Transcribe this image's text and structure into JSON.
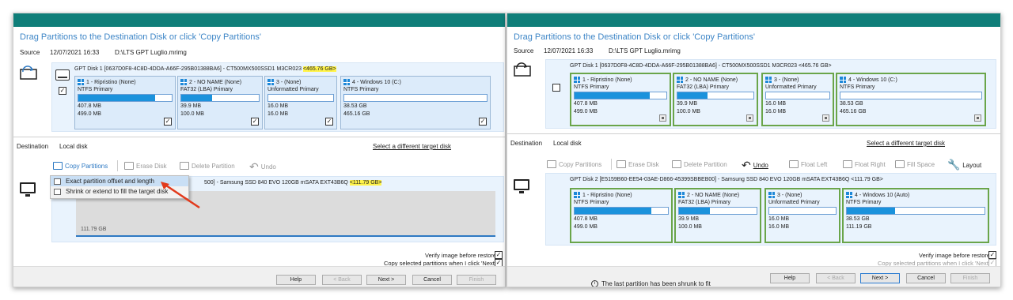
{
  "left": {
    "heading": "Drag Partitions to the Destination Disk or click 'Copy Partitions'",
    "source_label": "Source",
    "source_date": "12/07/2021 16:33",
    "source_path": "D:\\LTS GPT Luglio.mrimg",
    "disk_info": "GPT Disk 1 [0637D0F8-4C8D-4DDA-A66F-295B01388BA6] - CT500MX500SSD1 M3CR023",
    "disk_size": "<465.76 GB>",
    "partitions": [
      {
        "title": "1 - Ripristino (None)",
        "type": "NTFS Primary",
        "used": "407.8 MB",
        "total": "499.0 MB",
        "fill": 0.82
      },
      {
        "title": "2 - NO NAME (None)",
        "type": "FAT32 (LBA) Primary",
        "used": "39.9 MB",
        "total": "100.0 MB",
        "fill": 0.4
      },
      {
        "title": "3 - (None)",
        "type": "Unformatted Primary",
        "used": "16.0 MB",
        "total": "16.0 MB",
        "fill": 0.0
      },
      {
        "title": "4 - Windows 10 (C:)",
        "type": "NTFS Primary",
        "used": "38.53 GB",
        "total": "465.16 GB",
        "fill": 0.0
      }
    ],
    "destination_label": "Destination",
    "destination_value": "Local disk",
    "select_target": "Select a different target disk",
    "toolbar": {
      "copy": "Copy Partitions",
      "erase": "Erase Disk",
      "delete": "Delete Partition",
      "undo": "Undo"
    },
    "dest_disk_info": "500] - Samsung SSD 840 EVO 120GB mSATA EXT43B6Q",
    "dest_disk_size": "<111.79 GB>",
    "dest_free": "111.79 GB",
    "menu": {
      "item1": "Exact partition offset and length",
      "item2": "Shrink or extend to fill the target disk"
    },
    "verify": "Verify image before restore",
    "copy_selected": "Copy selected partitions when I click 'Next'",
    "buttons": {
      "help": "Help",
      "back": "< Back",
      "next": "Next >",
      "cancel": "Cancel",
      "finish": "Finish"
    }
  },
  "right": {
    "heading": "Drag Partitions to the Destination Disk or click 'Copy Partitions'",
    "source_label": "Source",
    "source_date": "12/07/2021 16:33",
    "source_path": "D:\\LTS GPT Luglio.mrimg",
    "disk_info": "GPT Disk 1 [0637D0F8-4C8D-4DDA-A66F-295B01388BA6] - CT500MX500SSD1 M3CR023 <465.76 GB>",
    "partitions": [
      {
        "title": "1 - Ripristino (None)",
        "type": "NTFS Primary",
        "used": "407.8 MB",
        "total": "499.0 MB",
        "fill": 0.82
      },
      {
        "title": "2 - NO NAME (None)",
        "type": "FAT32 (LBA) Primary",
        "used": "39.9 MB",
        "total": "100.0 MB",
        "fill": 0.4
      },
      {
        "title": "3 - (None)",
        "type": "Unformatted Primary",
        "used": "16.0 MB",
        "total": "16.0 MB",
        "fill": 0.0
      },
      {
        "title": "4 - Windows 10 (C:)",
        "type": "NTFS Primary",
        "used": "38.53 GB",
        "total": "465.16 GB",
        "fill": 0.0
      }
    ],
    "destination_label": "Destination",
    "destination_value": "Local disk",
    "select_target": "Select a different target disk",
    "toolbar": {
      "copy": "Copy Partitions",
      "erase": "Erase Disk",
      "delete": "Delete Partition",
      "undo": "Undo",
      "float_left": "Float Left",
      "float_right": "Float Right",
      "fill_space": "Fill Space",
      "layout": "Layout"
    },
    "dest_disk_info": "GPT Disk 2 [E5159B60-EE54-03AE-D866-45399SBBEB00] - Samsung SSD 840 EVO 120GB mSATA EXT43B6Q <111.79 GB>",
    "dest_partitions": [
      {
        "title": "1 - Ripristino (None)",
        "type": "NTFS Primary",
        "used": "407.8 MB",
        "total": "499.0 MB",
        "fill": 0.82
      },
      {
        "title": "2 - NO NAME (None)",
        "type": "FAT32 (LBA) Primary",
        "used": "39.9 MB",
        "total": "100.0 MB",
        "fill": 0.4
      },
      {
        "title": "3 - (None)",
        "type": "Unformatted Primary",
        "used": "16.0 MB",
        "total": "16.0 MB",
        "fill": 0.0
      },
      {
        "title": "4 - Windows 10 (Auto)",
        "type": "NTFS Primary",
        "used": "38.53 GB",
        "total": "111.19 GB",
        "fill": 0.35
      }
    ],
    "verify": "Verify image before restore",
    "copy_selected": "Copy selected partitions when I click 'Next'",
    "status": "The last partition has been shrunk to fit",
    "buttons": {
      "help": "Help",
      "back": "< Back",
      "next": "Next >",
      "cancel": "Cancel",
      "finish": "Finish"
    }
  }
}
